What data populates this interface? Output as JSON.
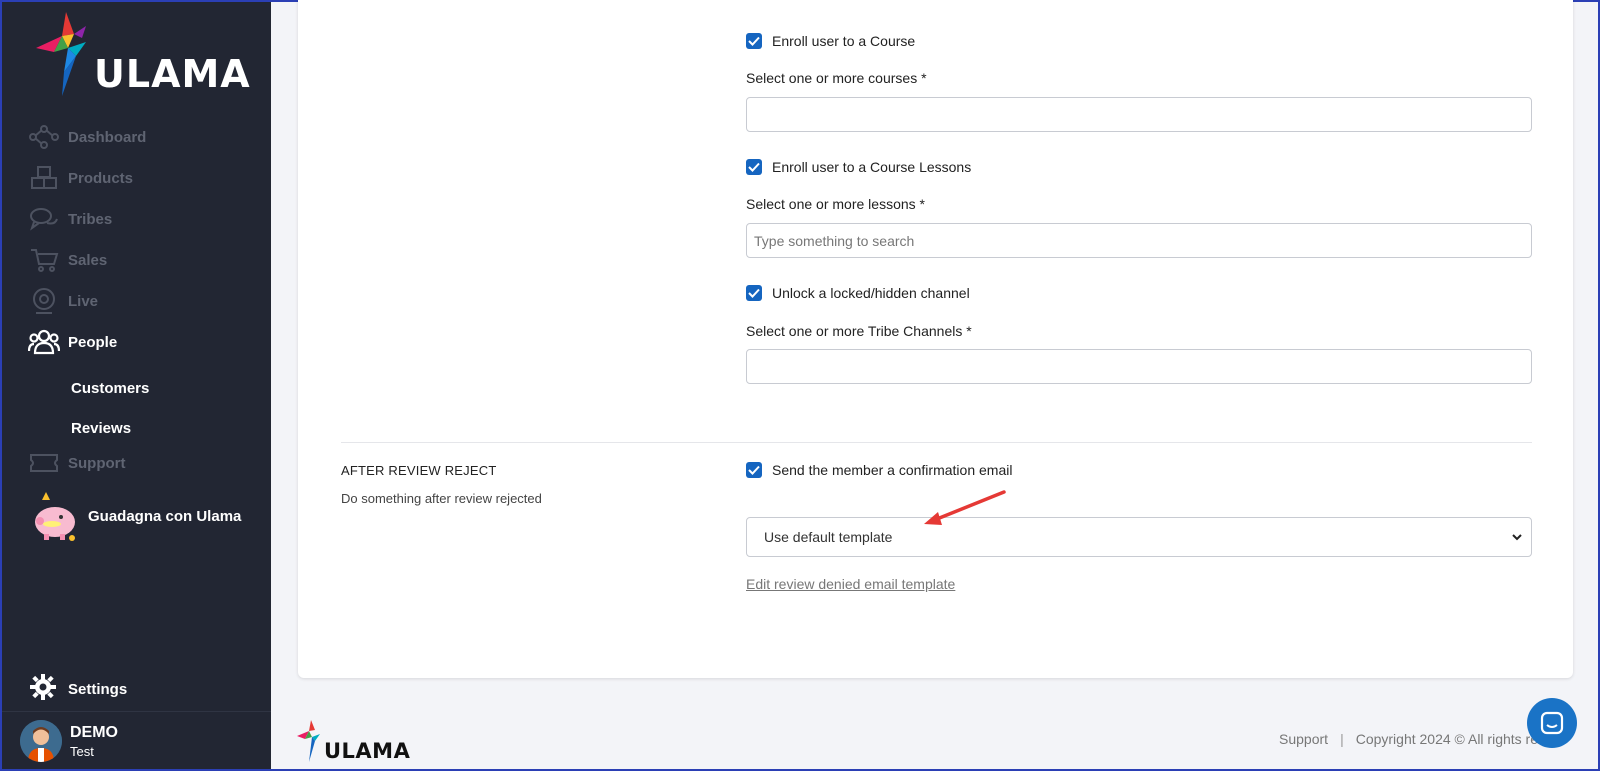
{
  "app": {
    "name": "ULAMA"
  },
  "sidebar": {
    "items": [
      {
        "label": "Dashboard",
        "icon": "network-icon"
      },
      {
        "label": "Products",
        "icon": "boxes-icon"
      },
      {
        "label": "Tribes",
        "icon": "chat-bubbles-icon"
      },
      {
        "label": "Sales",
        "icon": "cart-icon"
      },
      {
        "label": "Live",
        "icon": "webcam-icon"
      },
      {
        "label": "People",
        "icon": "people-icon",
        "active": true
      }
    ],
    "sub_items": [
      {
        "label": "Customers"
      },
      {
        "label": "Reviews"
      }
    ],
    "support": {
      "label": "Support",
      "icon": "ticket-icon"
    },
    "promo": {
      "label": "Guadagna con Ulama",
      "icon": "piggy-bank-icon"
    },
    "settings": {
      "label": "Settings",
      "icon": "gear-icon"
    },
    "user": {
      "name": "DEMO",
      "subtitle": "Test"
    }
  },
  "form": {
    "enroll_course": {
      "checked": true,
      "label": "Enroll user to a Course"
    },
    "courses_field": {
      "label": "Select one or more courses *",
      "value": ""
    },
    "enroll_lessons": {
      "checked": true,
      "label": "Enroll user to a Course Lessons"
    },
    "lessons_field": {
      "label": "Select one or more lessons *",
      "placeholder": "Type something to search"
    },
    "unlock_channel": {
      "checked": true,
      "label": "Unlock a locked/hidden channel"
    },
    "channels_field": {
      "label": "Select one or more Tribe Channels *",
      "value": ""
    },
    "after_reject": {
      "title": "AFTER REVIEW REJECT",
      "description": "Do something after review rejected",
      "send_email": {
        "checked": true,
        "label": "Send the member a confirmation email"
      },
      "template_select": {
        "value": "Use default template"
      },
      "edit_link": "Edit review denied email template"
    }
  },
  "footer": {
    "logo": "ULAMA",
    "support": "Support",
    "separator": "|",
    "copyright": "Copyright 2024 © All rights re"
  },
  "colors": {
    "sidebar_bg": "#222633",
    "accent": "#1565c0",
    "annotation_arrow": "#e53935"
  }
}
